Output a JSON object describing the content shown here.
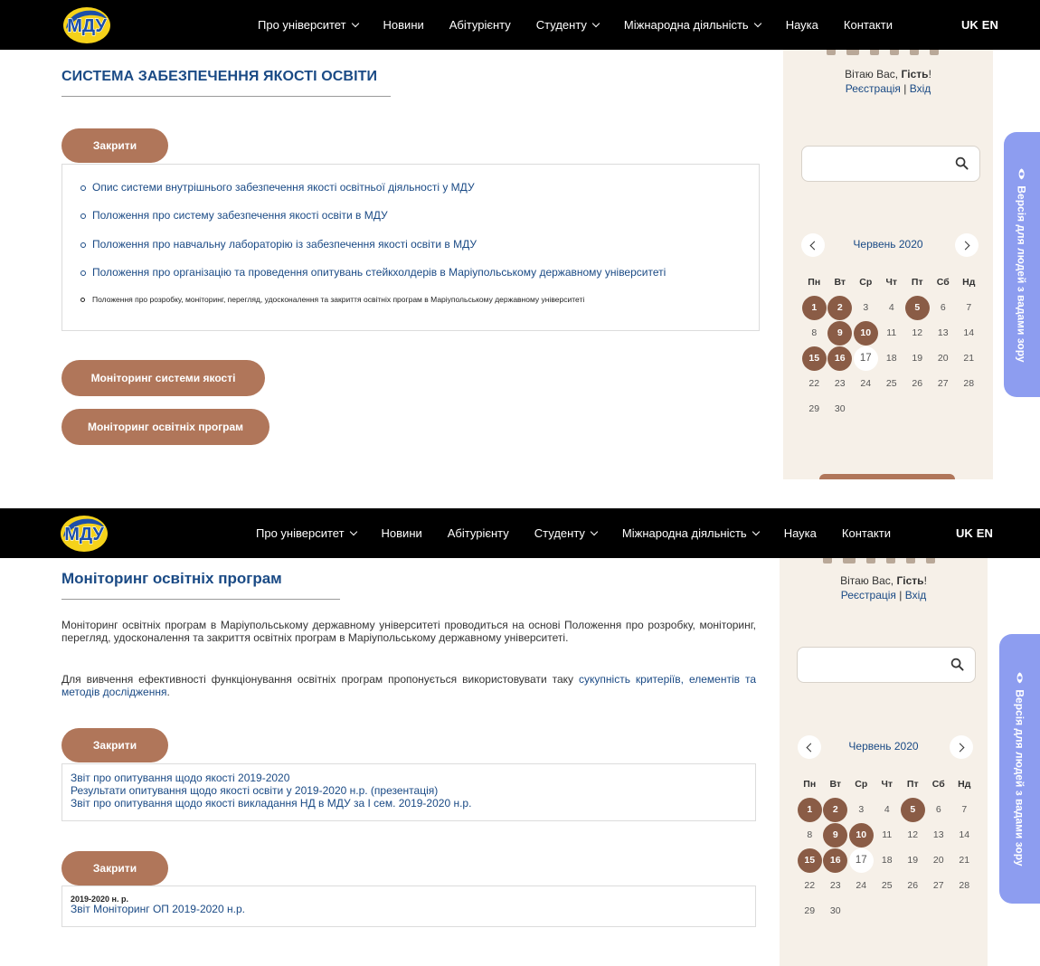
{
  "nav": {
    "items": [
      "Про університет",
      "Новини",
      "Абітурієнту",
      "Студенту",
      "Міжнародна діяльність",
      "Наука",
      "Контакти"
    ],
    "dropdown": [
      true,
      false,
      false,
      true,
      true,
      false,
      false
    ],
    "lang": [
      "UK",
      "EN"
    ]
  },
  "sidebar": {
    "greeting": "Вітаю Вас,",
    "guest": "Гість",
    "guest_suffix": "!",
    "register": "Реєстрація",
    "separator": " | ",
    "login": "Вхід",
    "search_placeholder": ""
  },
  "calendar": {
    "month": "Червень 2020",
    "dow": [
      "Пн",
      "Вт",
      "Ср",
      "Чт",
      "Пт",
      "Сб",
      "Нд"
    ],
    "days": [
      1,
      2,
      3,
      4,
      5,
      6,
      7,
      8,
      9,
      10,
      11,
      12,
      13,
      14,
      15,
      16,
      17,
      18,
      19,
      20,
      21,
      22,
      23,
      24,
      25,
      26,
      27,
      28,
      29,
      30
    ],
    "event_days": [
      1,
      2,
      5,
      9,
      10,
      15,
      16
    ],
    "today": 17
  },
  "a11y_label": "Версія для людей з вадами зору",
  "screen1": {
    "title": "СИСТЕМА ЗАБЕЗПЕЧЕННЯ ЯКОСТІ ОСВІТИ",
    "close_label": "Закрити",
    "documents": [
      "Опис системи внутрішнього забезпечення якості освітньої діяльності у МДУ",
      "Положення про систему забезпечення якості освіти в МДУ",
      "Положення про навчальну лабораторію із забезпечення якості освіти в МДУ",
      "Положення про організацію та проведення опитувань стейкхолдерів в Маріупольському державному університеті",
      "Положення про розробку, моніторинг, перегляд, удосконалення та закриття освітніх програм в Маріупольському державному університеті"
    ],
    "monitoring_system_label": "Моніторинг системи якості",
    "monitoring_programs_label": "Моніторинг освітніх програм"
  },
  "screen2": {
    "title": "Моніторинг освітніх програм",
    "paragraph1": "Моніторинг освітніх програм в Маріупольському державному університеті проводиться на основі Положення про розробку, моніторинг, перегляд, удосконалення та закриття освітніх програм в Маріупольському державному університеті.",
    "paragraph2_text": "Для вивчення ефективності функціонування освітніх програм пропонується використовувати таку ",
    "paragraph2_link": "сукупність критеріїв, елементів та методів дослідження",
    "paragraph2_end": ".",
    "close_label_1": "Закрити",
    "survey_links": [
      "Звіт про опитування щодо якості 2019-2020",
      "Результати опитування щодо якості освіти у 2019-2020 н.р. (презентація)",
      "Звіт про опитування щодо якості викладання НД в МДУ за І сем. 2019-2020 н.р."
    ],
    "close_label_2": "Закрити",
    "year_label": "2019-2020 н. р.",
    "report_link": "Звіт Моніторинг ОП 2019-2020 н.р."
  }
}
